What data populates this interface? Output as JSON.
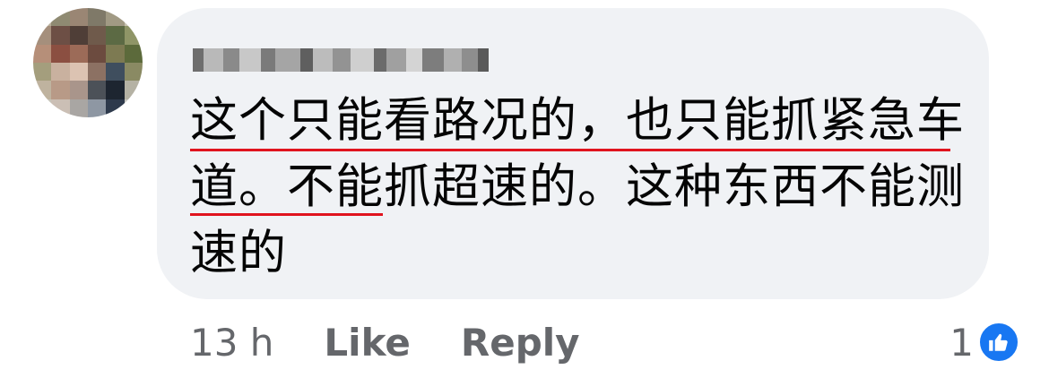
{
  "comment": {
    "text": "这个只能看路况的，也只能抓紧急车道。不能抓超速的。这种东西不能测速的"
  },
  "actions": {
    "timestamp": "13 h",
    "like_label": "Like",
    "reply_label": "Reply"
  },
  "reactions": {
    "count": "1",
    "icon": "thumbs-up-icon",
    "badge_color": "#1877f2"
  },
  "colors": {
    "bubble": "#f0f2f5",
    "text": "#050505",
    "meta": "#65676b",
    "underline": "#e0141e"
  }
}
